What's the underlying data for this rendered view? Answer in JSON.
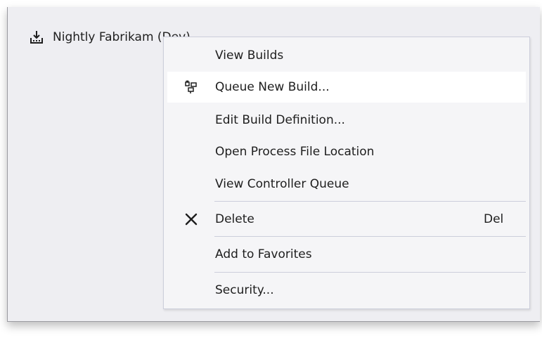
{
  "tree": {
    "item_label": "Nightly Fabrikam (Dev)",
    "item_icon": "build-download-icon"
  },
  "context_menu": {
    "items": [
      {
        "label": "View Builds",
        "icon": "",
        "shortcut": ""
      },
      {
        "label": "Queue New Build...",
        "icon": "queue-build-icon",
        "shortcut": ""
      },
      {
        "label": "Edit Build Definition...",
        "icon": "",
        "shortcut": ""
      },
      {
        "label": "Open Process File Location",
        "icon": "",
        "shortcut": ""
      },
      {
        "label": "View Controller Queue",
        "icon": "",
        "shortcut": ""
      },
      {
        "label": "Delete",
        "icon": "delete-x-icon",
        "shortcut": "Del"
      },
      {
        "label": "Add to Favorites",
        "icon": "",
        "shortcut": ""
      },
      {
        "label": "Security...",
        "icon": "",
        "shortcut": ""
      }
    ],
    "hovered_index": 1
  },
  "colors": {
    "panel_bg": "#eeeef2",
    "menu_bg": "#f5f5f7",
    "menu_border": "#cccedb",
    "hover_bg": "#ffffff",
    "text": "#1e1e1e"
  }
}
